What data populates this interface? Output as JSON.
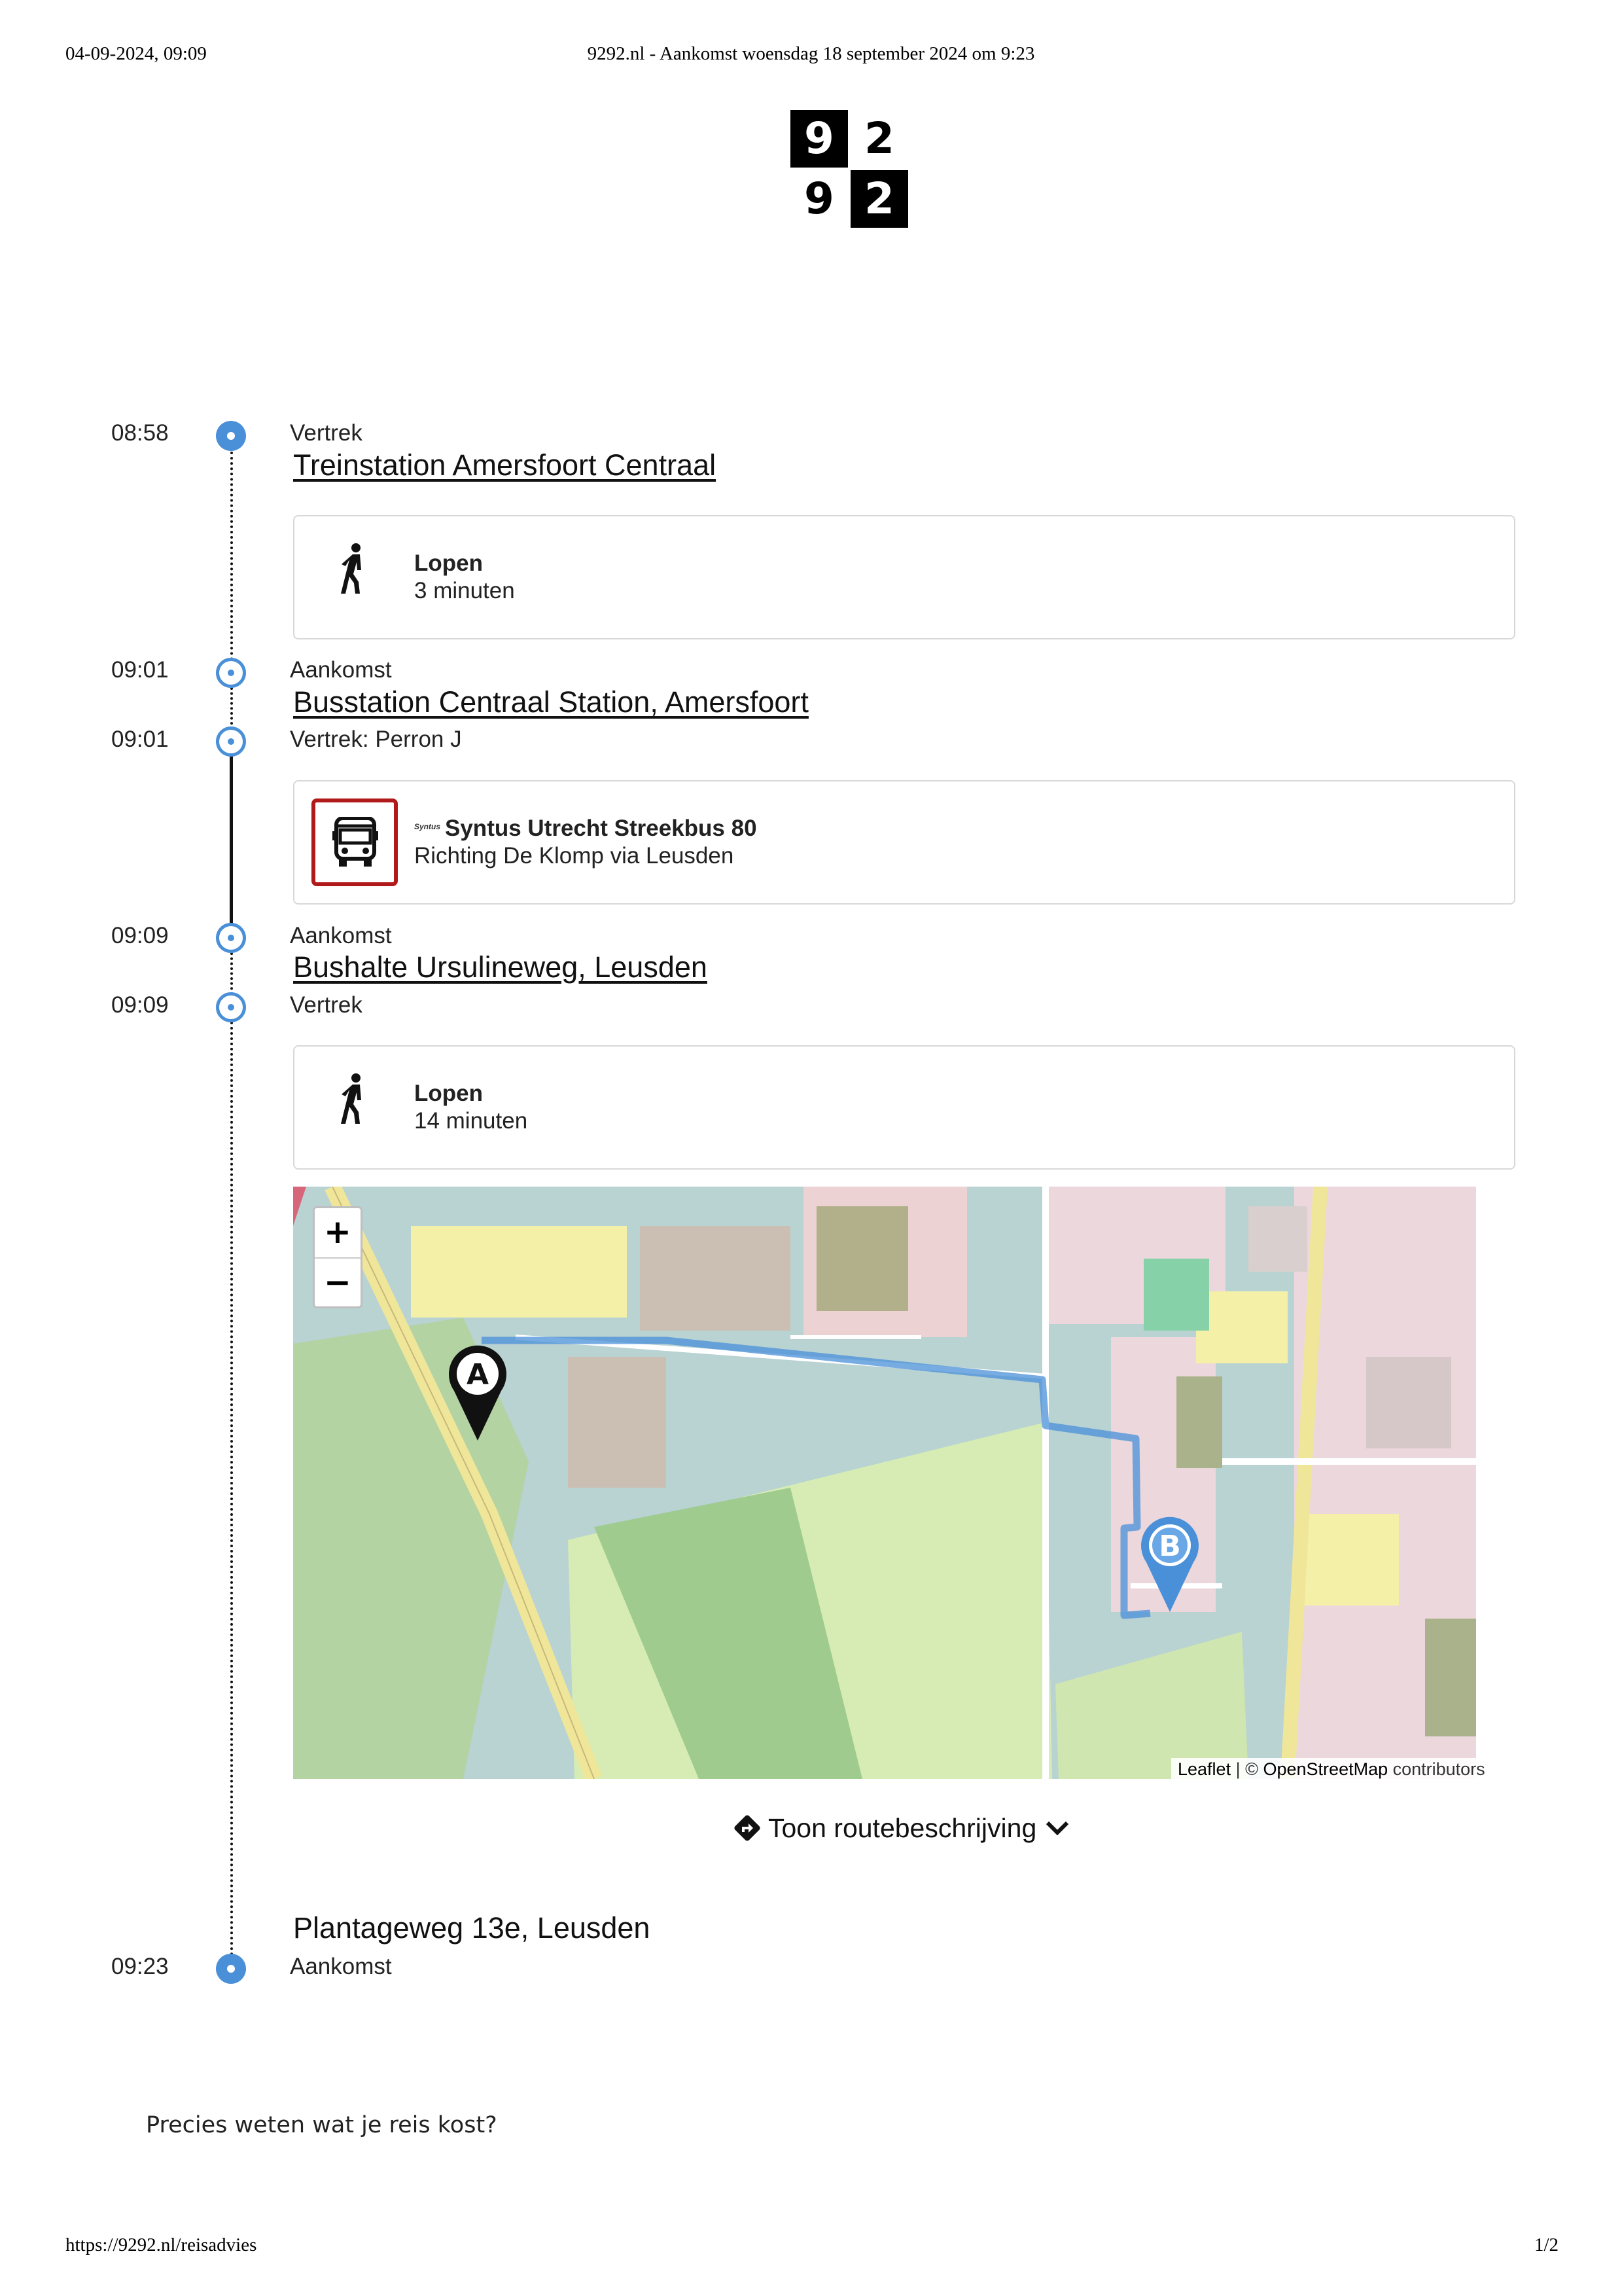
{
  "print_header": {
    "date": "04-09-2024, 09:09",
    "title": "9292.nl - Aankomst woensdag 18 september 2024 om 9:23"
  },
  "logo": {
    "cells": [
      "9",
      "2",
      "9",
      "2"
    ]
  },
  "timeline": {
    "departure_time": "08:58",
    "departure_label": "Vertrek",
    "departure_stop": "Treinstation Amersfoort Centraal",
    "walk1": {
      "title": "Lopen",
      "duration": "3 minuten"
    },
    "arrival1_time": "09:01",
    "arrival1_label": "Aankomst",
    "arrival1_stop": "Busstation Centraal Station, Amersfoort",
    "departure2_time": "09:01",
    "departure2_label": "Vertrek: Perron J",
    "bus": {
      "operator_logo": "Syntus",
      "title": "Syntus Utrecht Streekbus 80",
      "direction": "Richting De Klomp via Leusden",
      "accent_color": "#b01a1a"
    },
    "arrival2_time": "09:09",
    "arrival2_label": "Aankomst",
    "arrival2_stop": "Bushalte Ursulineweg, Leusden",
    "departure3_time": "09:09",
    "departure3_label": "Vertrek",
    "walk2": {
      "title": "Lopen",
      "duration": "14 minuten"
    },
    "final_stop": "Plantageweg 13e, Leusden",
    "final_time": "09:23",
    "final_label": "Aankomst"
  },
  "map": {
    "zoom_in": "+",
    "zoom_out": "−",
    "marker_a": "A",
    "marker_b": "B",
    "attribution_leaflet": "Leaflet",
    "attribution_sep": " | © ",
    "attribution_osm": "OpenStreetMap",
    "attribution_rest": " contributors",
    "route_color": "#4a90d9"
  },
  "route_toggle": {
    "label": "Toon routebeschrijving"
  },
  "promo": {
    "text": "Precies weten wat je reis kost?"
  },
  "print_footer": {
    "url": "https://9292.nl/reisadvies",
    "page": "1/2"
  }
}
